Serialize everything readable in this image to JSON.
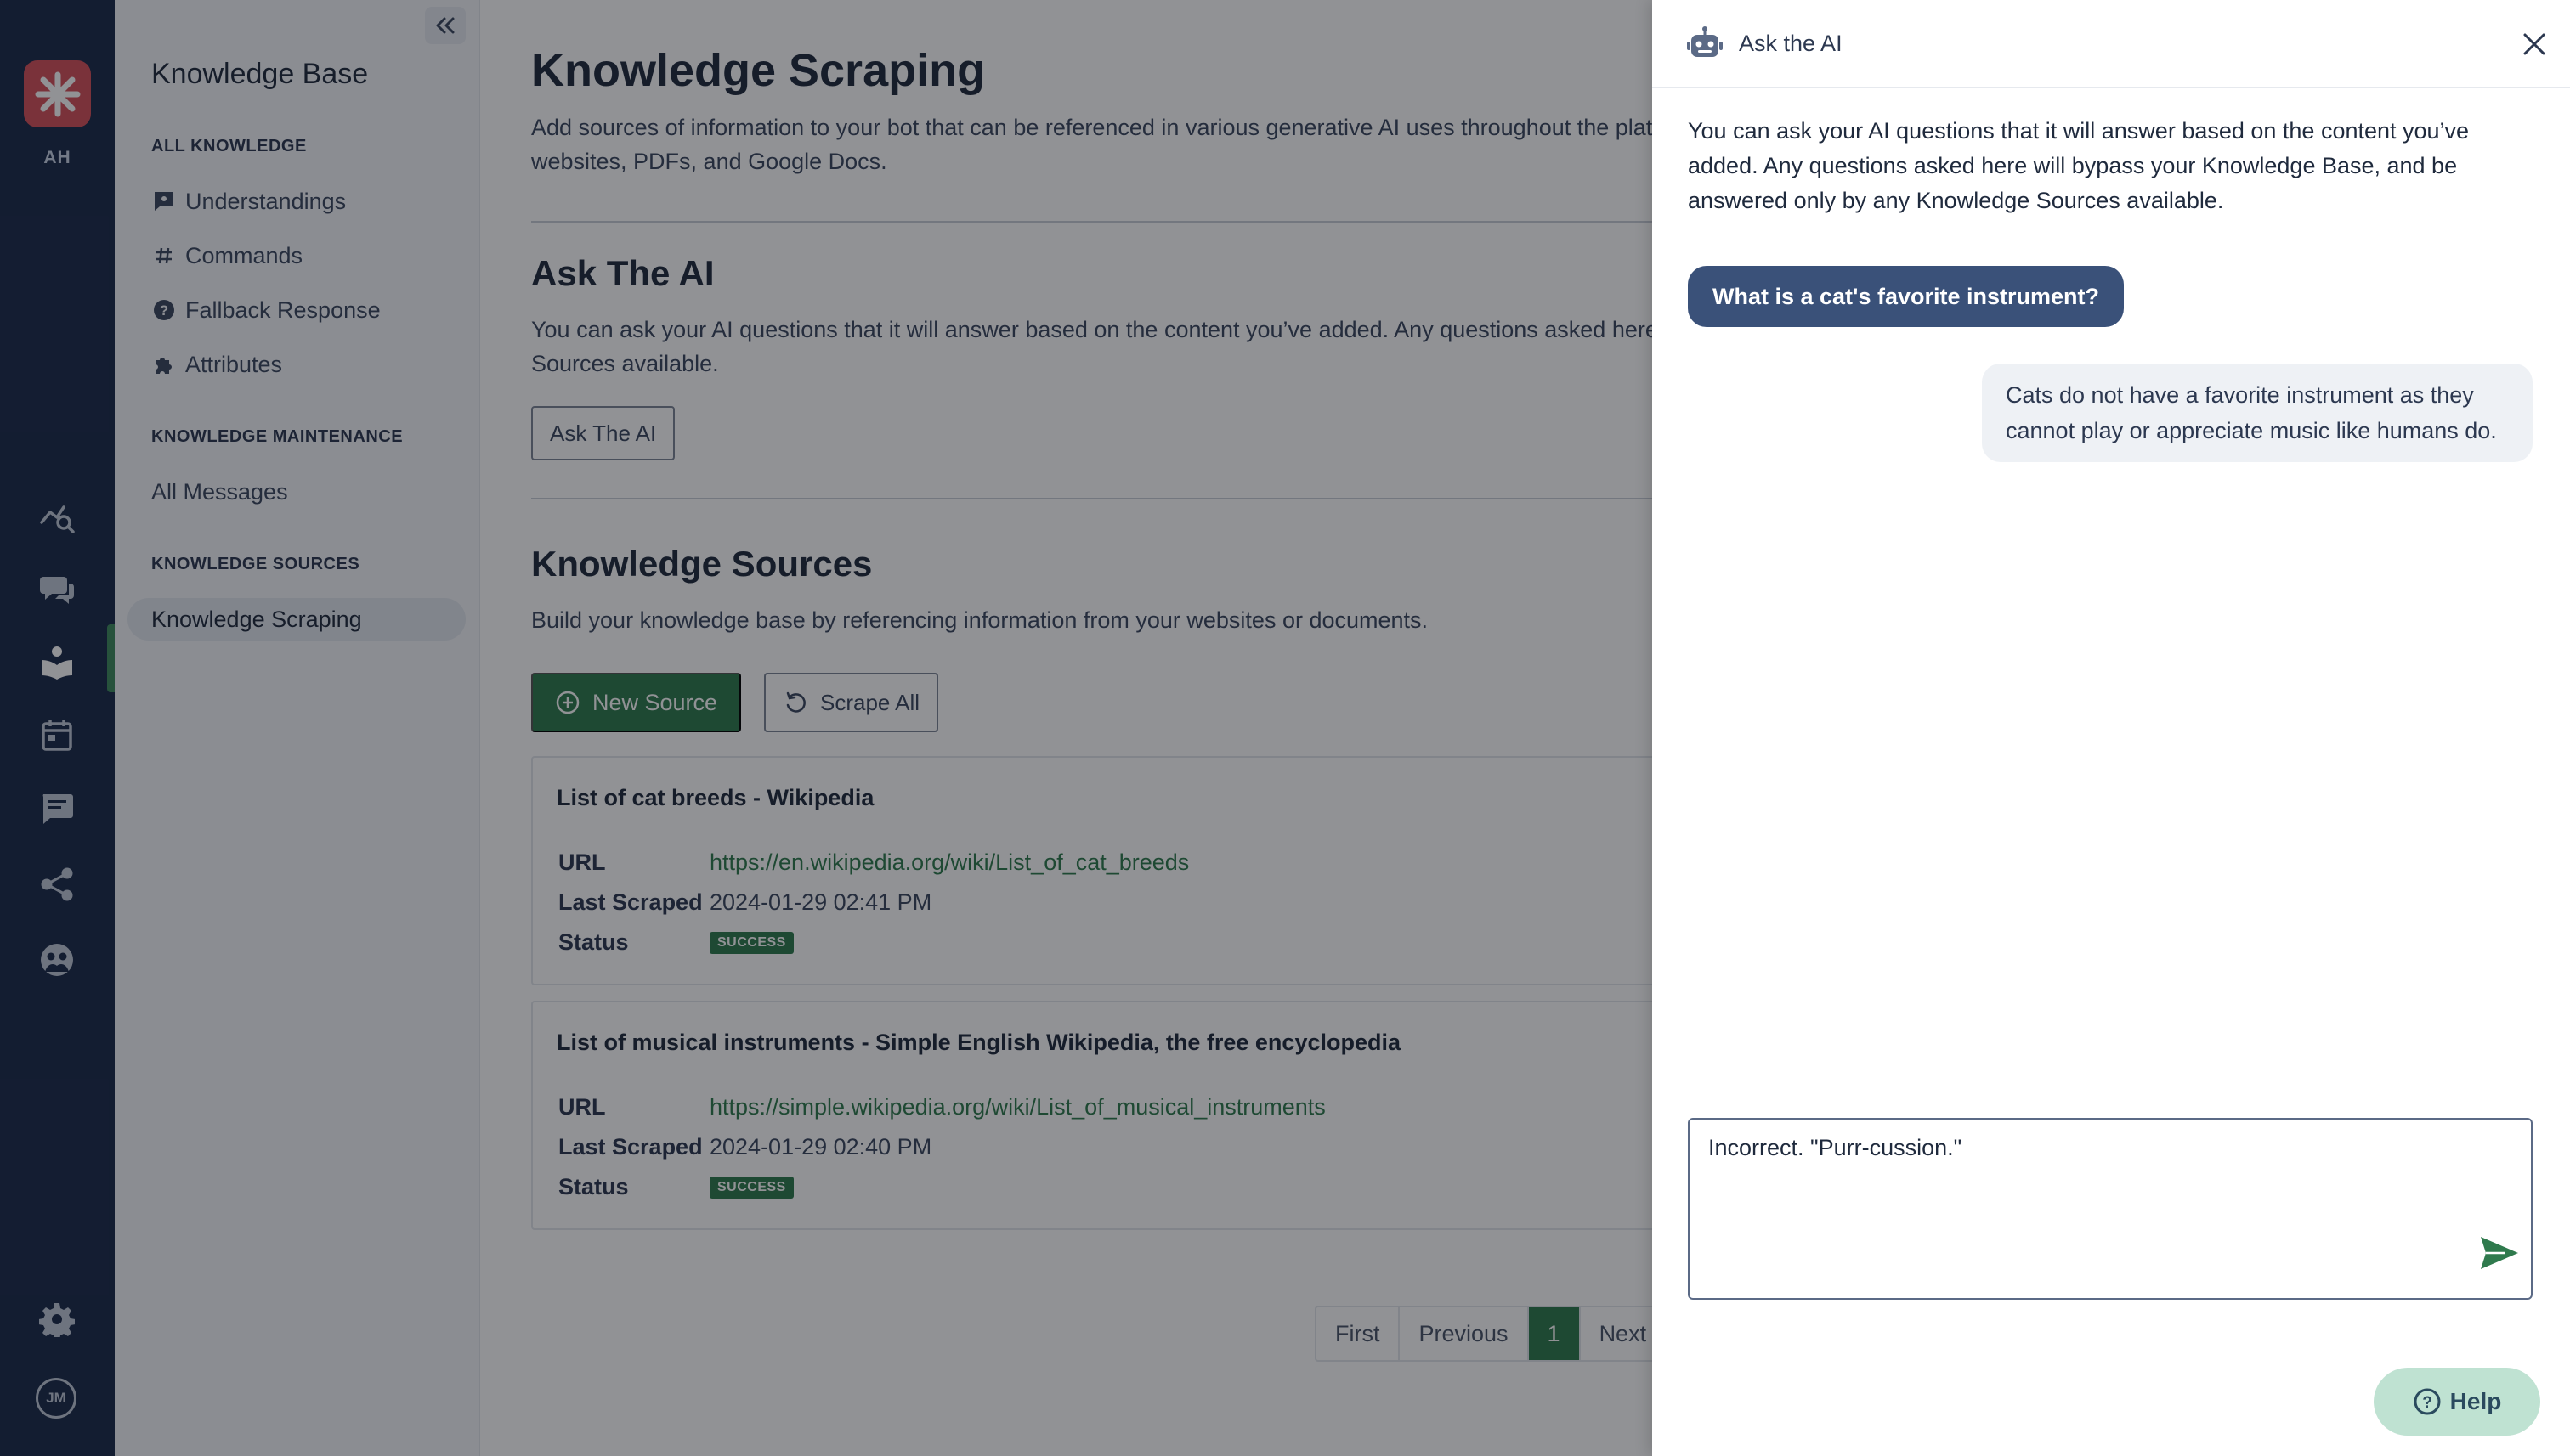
{
  "rail": {
    "org_initials": "AH",
    "user_initials": "JM",
    "nav_icons": [
      "analytics-icon",
      "conversations-icon",
      "knowledge-icon",
      "calendar-icon",
      "messages-icon",
      "share-icon",
      "audience-icon"
    ],
    "accent": "#d6505a"
  },
  "sidebar": {
    "title": "Knowledge Base",
    "sections": {
      "all_knowledge": "ALL KNOWLEDGE",
      "maintenance": "KNOWLEDGE MAINTENANCE",
      "sources": "KNOWLEDGE SOURCES"
    },
    "items": {
      "understandings": "Understandings",
      "commands": "Commands",
      "fallback": "Fallback Response",
      "attributes": "Attributes",
      "all_messages": "All Messages",
      "scraping": "Knowledge Scraping"
    }
  },
  "main": {
    "title": "Knowledge Scraping",
    "desc_line1": "Add sources of information to your bot that can be referenced in various generative AI uses throughout the plat",
    "desc_line2": "websites, PDFs, and Google Docs.",
    "ask": {
      "title": "Ask The AI",
      "desc_line1": "You can ask your AI questions that it will answer based on the content you’ve added. Any questions asked here",
      "desc_line2": "Sources available.",
      "button": "Ask The AI"
    },
    "sources": {
      "title": "Knowledge Sources",
      "desc": "Build your knowledge base by referencing information from your websites or documents.",
      "new_button": "New Source",
      "scrape_button": "Scrape All",
      "labels": {
        "url": "URL",
        "last_scraped": "Last Scraped",
        "status": "Status"
      },
      "items": [
        {
          "title": "List of cat breeds - Wikipedia",
          "url": "https://en.wikipedia.org/wiki/List_of_cat_breeds",
          "last_scraped": "2024-01-29 02:41 PM",
          "status": "SUCCESS"
        },
        {
          "title": "List of musical instruments - Simple English Wikipedia, the free encyclopedia",
          "url": "https://simple.wikipedia.org/wiki/List_of_musical_instruments",
          "last_scraped": "2024-01-29 02:40 PM",
          "status": "SUCCESS"
        }
      ]
    },
    "pagination": {
      "first": "First",
      "previous": "Previous",
      "current": "1",
      "next": "Next"
    }
  },
  "drawer": {
    "title": "Ask the AI",
    "intro": "You can ask your AI questions that it will answer based on the content you’ve added. Any questions asked here will bypass your Knowledge Base, and be answered only by any Knowledge Sources available.",
    "user_message": "What is a cat's favorite instrument?",
    "ai_message": "Cats do not have a favorite instrument as they cannot play or appreciate music like humans do.",
    "input_value": "Incorrect. \"Purr-cussion.\""
  },
  "help": {
    "label": "Help"
  }
}
